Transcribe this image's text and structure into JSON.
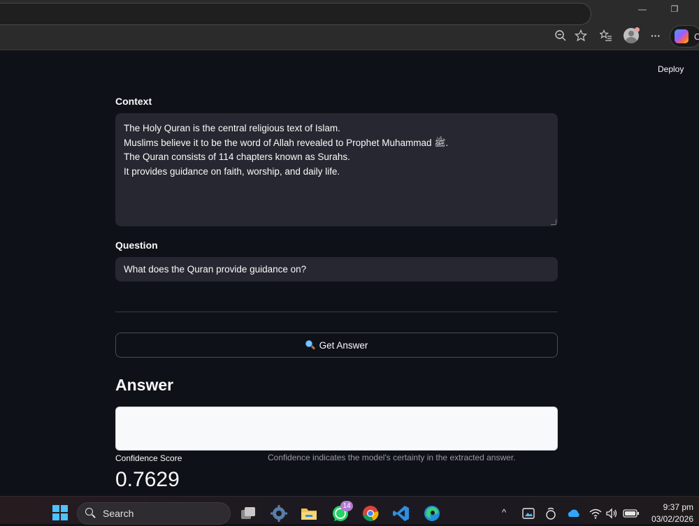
{
  "browser": {
    "window_controls": {
      "minimize": "—",
      "restore": "❐"
    },
    "toolbar_icons": [
      "zoom-icon",
      "favorite-star-icon",
      "favorites-list-icon",
      "profile-avatar-icon",
      "more-options-icon",
      "copilot-icon"
    ],
    "more_label": "···",
    "copilot_label": "C"
  },
  "app": {
    "deploy_label": "Deploy",
    "menu_label": "⋮",
    "context_label": "Context",
    "context_lines": [
      "The Holy Quran is the central religious text of Islam.",
      "Muslims believe it to be the word of Allah revealed to Prophet Muhammad ﷺ.",
      "The Quran consists of 114 chapters known as Surahs.",
      "It provides guidance on faith, worship, and daily life."
    ],
    "question_label": "Question",
    "question_value": "What does the Quran provide guidance on?",
    "button_label": "Get Answer",
    "answer_heading": "Answer",
    "answer_value": "",
    "confidence_label": "Confidence Score",
    "confidence_note": "Confidence indicates the model's certainty in the extracted answer.",
    "confidence_value": "0.7629"
  },
  "taskbar": {
    "search_label": "Search",
    "whatsapp_badge": "14",
    "tray_chevron": "^",
    "clock_time": "9:37 pm",
    "clock_date": "03/02/2026"
  },
  "colors": {
    "app_background": "#0e1117",
    "input_background": "#262730",
    "answer_background": "#f8f9fb",
    "accent_blue": "#4cc2ff"
  }
}
